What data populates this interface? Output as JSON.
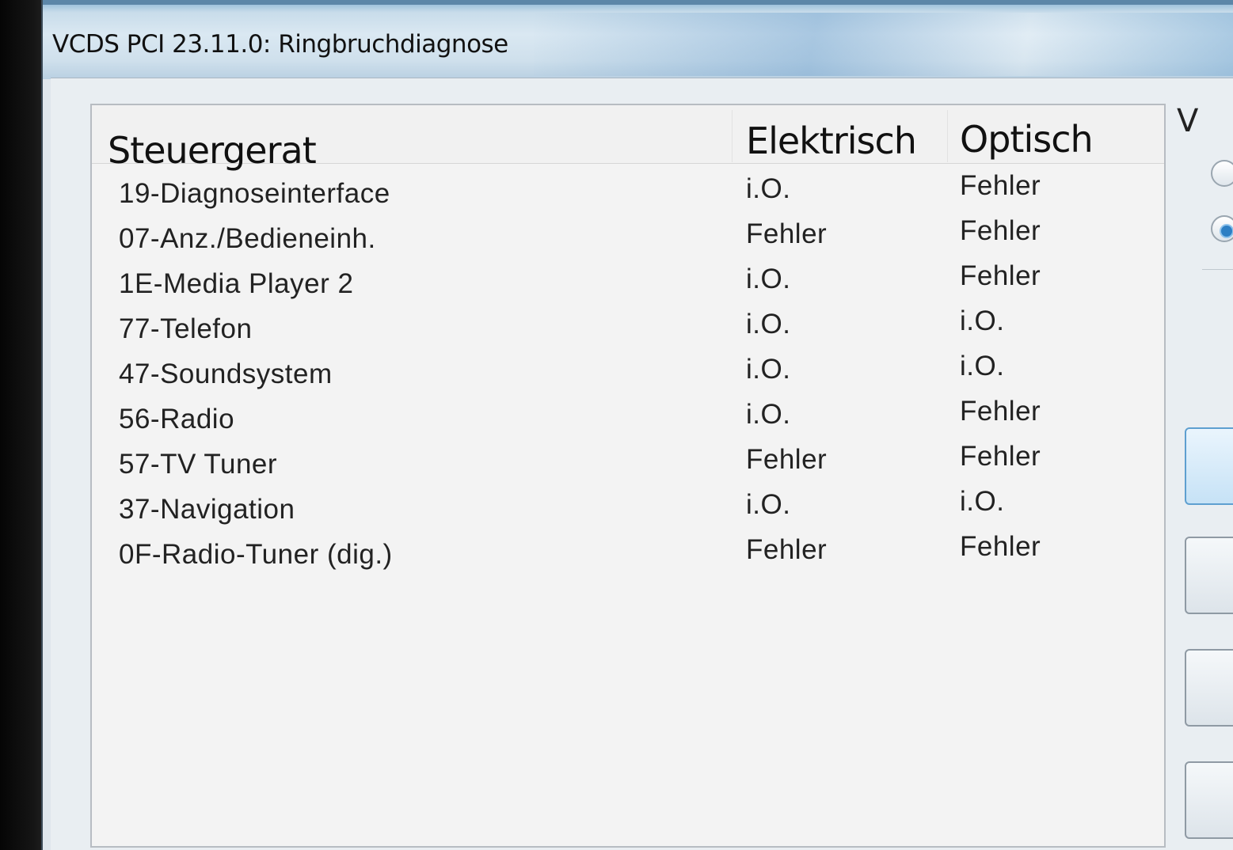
{
  "window": {
    "title": "VCDS PCI 23.11.0:  Ringbruchdiagnose"
  },
  "table": {
    "columns": [
      "Steuergerat",
      "Elektrisch",
      "Optisch"
    ],
    "rows": [
      {
        "steuergerat": "19-Diagnoseinterface",
        "elektrisch": "i.O.",
        "optisch": "Fehler"
      },
      {
        "steuergerat": "07-Anz./Bedieneinh.",
        "elektrisch": "Fehler",
        "optisch": "Fehler"
      },
      {
        "steuergerat": "1E-Media Player 2",
        "elektrisch": "i.O.",
        "optisch": "Fehler"
      },
      {
        "steuergerat": "77-Telefon",
        "elektrisch": "i.O.",
        "optisch": "i.O."
      },
      {
        "steuergerat": "47-Soundsystem",
        "elektrisch": "i.O.",
        "optisch": "i.O."
      },
      {
        "steuergerat": "56-Radio",
        "elektrisch": "i.O.",
        "optisch": "Fehler"
      },
      {
        "steuergerat": "57-TV Tuner",
        "elektrisch": "Fehler",
        "optisch": "Fehler"
      },
      {
        "steuergerat": "37-Navigation",
        "elektrisch": "i.O.",
        "optisch": "i.O."
      },
      {
        "steuergerat": "0F-Radio-Tuner (dig.)",
        "elektrisch": "Fehler",
        "optisch": "Fehler"
      }
    ]
  },
  "side_panel": {
    "heading_fragment": "V",
    "radio_selected_index": 1,
    "radio_icons": [
      "radio-unselected-icon",
      "radio-selected-icon"
    ]
  },
  "colors": {
    "titlebar": "#dae8f2",
    "list_background": "#f3f3f3",
    "selected_radio": "#2d7fc4"
  }
}
